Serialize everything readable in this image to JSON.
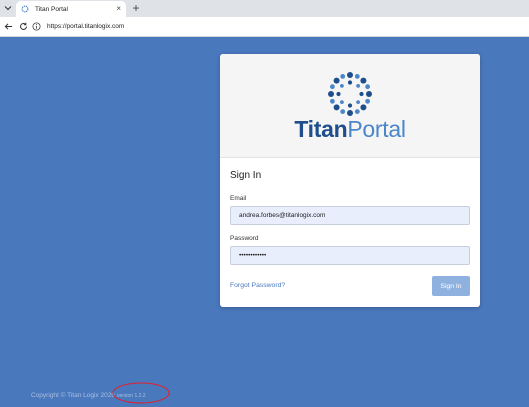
{
  "browser": {
    "tab_title": "Titan Portal",
    "tab_close": "×",
    "new_tab": "+",
    "url": "https://portal.titanlogix.com"
  },
  "brand": {
    "word1": "Titan",
    "word2": "Portal"
  },
  "form": {
    "title": "Sign In",
    "email_label": "Email",
    "email_value": "andrea.forbes@titanlogix.com",
    "password_label": "Password",
    "password_value": "••••••••••••",
    "forgot_link": "Forgot Password?",
    "submit_label": "Sign In"
  },
  "footer": {
    "copyright": "Copyright © Titan Logix 2026",
    "version": "version 1.2.2"
  },
  "colors": {
    "background": "#4a78bd",
    "brand_dark": "#1f4e8c",
    "brand_light": "#4a86c8",
    "annotation": "#e0202a"
  },
  "icons": {
    "tab_list": "chevron-down-icon",
    "favicon": "titan-logo-icon",
    "close": "close-icon",
    "new_tab": "plus-icon",
    "back": "back-arrow-icon",
    "reload": "reload-icon",
    "site_info": "site-info-icon"
  }
}
